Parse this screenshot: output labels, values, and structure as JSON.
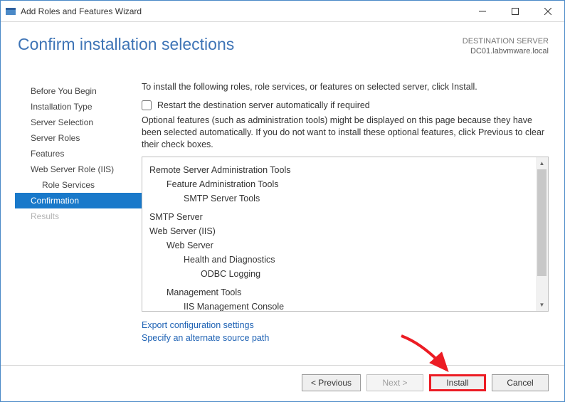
{
  "window": {
    "title": "Add Roles and Features Wizard"
  },
  "header": {
    "heading": "Confirm installation selections",
    "dest_label": "DESTINATION SERVER",
    "dest_value": "DC01.labvmware.local"
  },
  "sidebar": {
    "items": [
      {
        "label": "Before You Begin",
        "state": ""
      },
      {
        "label": "Installation Type",
        "state": ""
      },
      {
        "label": "Server Selection",
        "state": ""
      },
      {
        "label": "Server Roles",
        "state": ""
      },
      {
        "label": "Features",
        "state": ""
      },
      {
        "label": "Web Server Role (IIS)",
        "state": ""
      },
      {
        "label": "Role Services",
        "state": "indent"
      },
      {
        "label": "Confirmation",
        "state": "sel"
      },
      {
        "label": "Results",
        "state": "disabled"
      }
    ]
  },
  "main": {
    "intro": "To install the following roles, role services, or features on selected server, click Install.",
    "checkbox_label": "Restart the destination server automatically if required",
    "checkbox_checked": false,
    "note": "Optional features (such as administration tools) might be displayed on this page because they have been selected automatically. If you do not want to install these optional features, click Previous to clear their check boxes.",
    "tree": [
      {
        "level": 0,
        "text": "Remote Server Administration Tools"
      },
      {
        "level": 1,
        "text": "Feature Administration Tools"
      },
      {
        "level": 2,
        "text": "SMTP Server Tools"
      },
      {
        "level": -1,
        "text": ""
      },
      {
        "level": 0,
        "text": "SMTP Server"
      },
      {
        "level": 0,
        "text": "Web Server (IIS)"
      },
      {
        "level": 1,
        "text": "Web Server"
      },
      {
        "level": 2,
        "text": "Health and Diagnostics"
      },
      {
        "level": 3,
        "text": "ODBC Logging"
      },
      {
        "level": -1,
        "text": ""
      },
      {
        "level": 1,
        "text": "Management Tools"
      },
      {
        "level": 2,
        "text": "IIS Management Console"
      }
    ],
    "links": {
      "export": "Export configuration settings",
      "source": "Specify an alternate source path"
    }
  },
  "footer": {
    "previous": "< Previous",
    "next": "Next >",
    "install": "Install",
    "cancel": "Cancel"
  }
}
